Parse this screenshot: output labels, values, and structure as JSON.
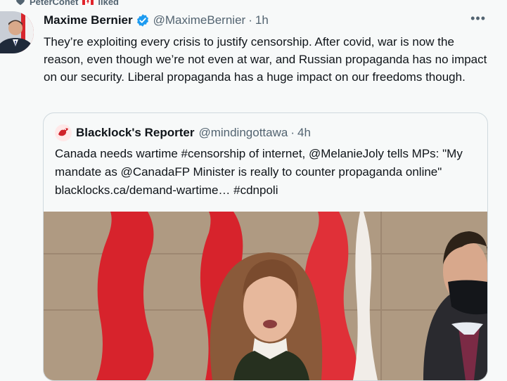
{
  "liked_banner": {
    "user": "PeterConet",
    "suffix": "liked"
  },
  "tweet": {
    "author_name": "Maxime Bernier",
    "author_handle": "@MaximeBernier",
    "separator": "·",
    "time": "1h",
    "more": "•••",
    "text": "They’re exploiting every crisis to justify censorship. After covid, war is now the reason, even though we’re not even at war, and Russian propaganda has no impact on our security. Liberal propaganda has a huge impact on our freedoms though."
  },
  "quote": {
    "author_name": "Blacklock's Reporter",
    "author_handle": "@mindingottawa",
    "separator": "·",
    "time": "4h",
    "text": "Canada needs wartime #censorship of internet, @MelanieJoly tells MPs: \"My mandate as  @CanadaFP Minister is really to counter propaganda online\" blacklocks.ca/demand-wartime… #cdnpoli"
  },
  "colors": {
    "text": "#0f1419",
    "muted": "#536471",
    "verified": "#1d9bf0",
    "border": "#cfd9de",
    "background": "#f7f9f9"
  }
}
